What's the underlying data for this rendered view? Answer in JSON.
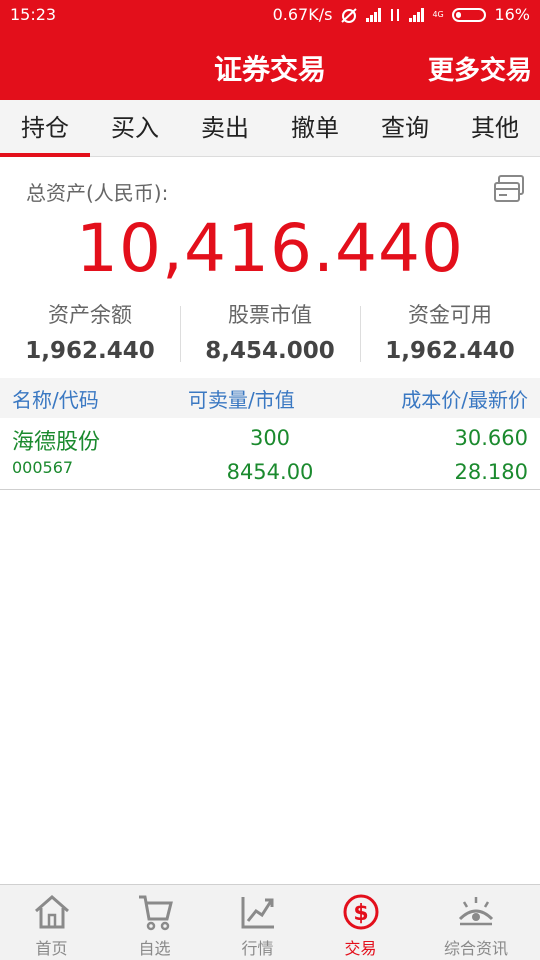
{
  "status_bar": {
    "time": "15:23",
    "net_speed": "0.67K/s",
    "net_type": "4G",
    "battery": "16%"
  },
  "header": {
    "title": "证券交易",
    "more": "更多交易"
  },
  "tabs": [
    {
      "label": "持仓",
      "active": true
    },
    {
      "label": "买入",
      "active": false
    },
    {
      "label": "卖出",
      "active": false
    },
    {
      "label": "撤单",
      "active": false
    },
    {
      "label": "查询",
      "active": false
    },
    {
      "label": "其他",
      "active": false
    }
  ],
  "summary": {
    "total_label": "总资产(人民币):",
    "total_value": "10,416.440",
    "stats": [
      {
        "label": "资产余额",
        "value": "1,962.440"
      },
      {
        "label": "股票市值",
        "value": "8,454.000"
      },
      {
        "label": "资金可用",
        "value": "1,962.440"
      }
    ]
  },
  "table": {
    "columns": [
      "名称/代码",
      "可卖量/市值",
      "成本价/最新价"
    ],
    "rows": [
      {
        "name": "海德股份",
        "code": "000567",
        "sellable_qty": "300",
        "market_value": "8454.00",
        "cost_price": "30.660",
        "latest_price": "28.180"
      }
    ]
  },
  "bottom_nav": [
    {
      "label": "首页",
      "icon": "home-icon",
      "active": false
    },
    {
      "label": "自选",
      "icon": "cart-icon",
      "active": false
    },
    {
      "label": "行情",
      "icon": "trend-chart-icon",
      "active": false
    },
    {
      "label": "交易",
      "icon": "dollar-circle-icon",
      "active": true
    },
    {
      "label": "综合资讯",
      "icon": "eye-radar-icon",
      "active": false
    }
  ],
  "colors": {
    "brand_red": "#e30f1b",
    "link_blue": "#3a78c2",
    "profit_green": "#1b8a2e"
  }
}
